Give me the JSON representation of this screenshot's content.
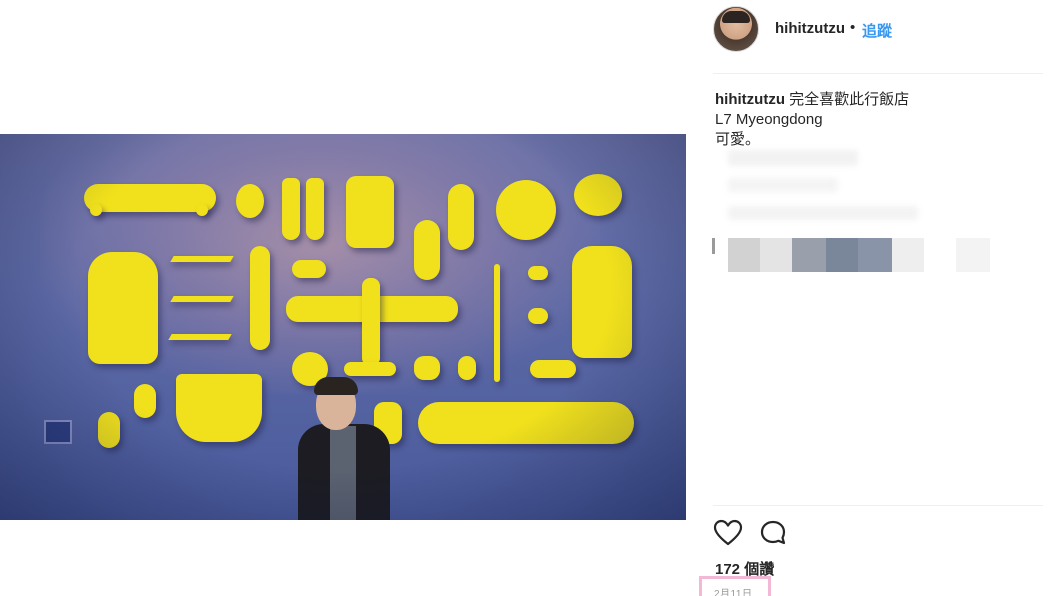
{
  "header": {
    "username": "hihitzutzu",
    "separator": "•",
    "follow_label": "追蹤"
  },
  "caption": {
    "username": "hihitzutzu",
    "line1": "完全喜歡此行飯店",
    "line2": "L7 Myeongdong",
    "line3": "可愛。"
  },
  "actions": {
    "like_icon": "heart-icon",
    "comment_icon": "comment-icon"
  },
  "likes_text": "172 個讚",
  "date_text": "2月11日",
  "colors": {
    "accent_link": "#3897f0",
    "photo_yellow": "#f1e11c",
    "wall_blue": "#5d6aa6",
    "date_highlight": "#f2b8d6"
  }
}
